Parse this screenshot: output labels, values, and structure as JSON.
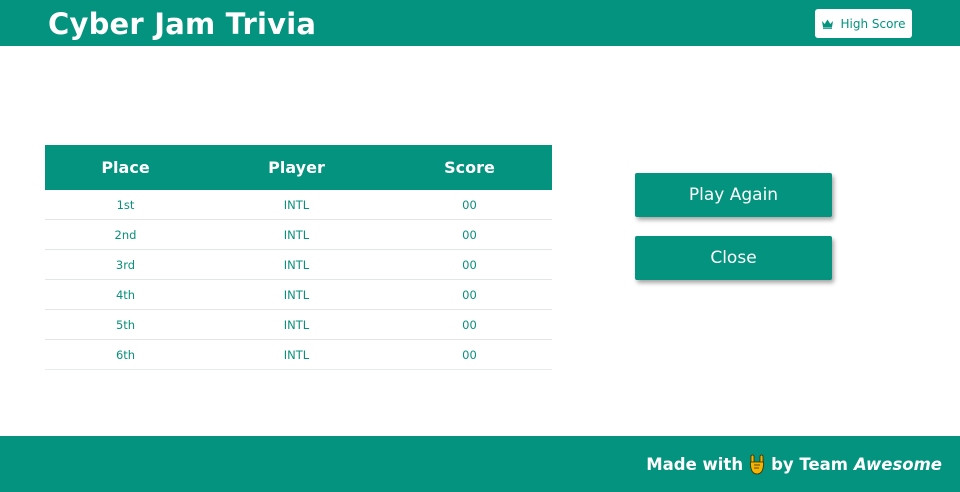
{
  "header": {
    "title": "Cyber Jam Trivia",
    "high_score_button": {
      "label": "High Score",
      "icon": "crown-icon"
    }
  },
  "scoreboard": {
    "columns": [
      "Place",
      "Player",
      "Score"
    ],
    "rows": [
      {
        "place": "1st",
        "player": "INTL",
        "score": "00"
      },
      {
        "place": "2nd",
        "player": "INTL",
        "score": "00"
      },
      {
        "place": "3rd",
        "player": "INTL",
        "score": "00"
      },
      {
        "place": "4th",
        "player": "INTL",
        "score": "00"
      },
      {
        "place": "5th",
        "player": "INTL",
        "score": "00"
      },
      {
        "place": "6th",
        "player": "INTL",
        "score": "00"
      }
    ]
  },
  "actions": {
    "play_again_label": "Play Again",
    "close_label": "Close"
  },
  "footer": {
    "made_with": "Made with",
    "icon": "rock-on-hand-icon",
    "by_team": "by Team",
    "team_name": "Awesome"
  },
  "colors": {
    "accent": "#03937e",
    "background": "#ffffff",
    "text_on_accent": "#ffffff"
  }
}
